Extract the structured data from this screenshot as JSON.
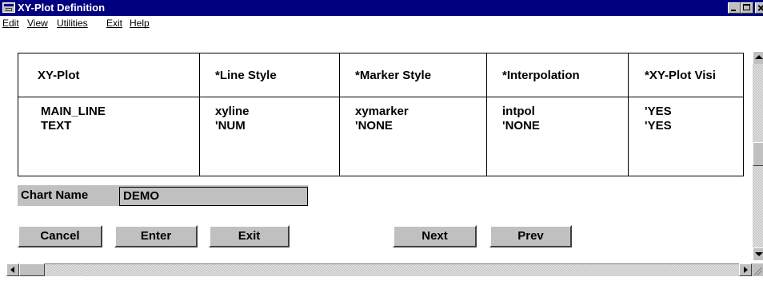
{
  "window": {
    "title": "XY-Plot Definition"
  },
  "menu": {
    "items": [
      {
        "label": "Edit"
      },
      {
        "label": "View"
      },
      {
        "label": "Utilities"
      },
      {
        "label": "Exit"
      },
      {
        "label": "Help"
      }
    ]
  },
  "table": {
    "headers": [
      "XY-Plot",
      "*Line Style",
      "*Marker Style",
      "*Interpolation",
      "*XY-Plot Visi"
    ],
    "rows": [
      [
        "MAIN_LINE",
        "xyline",
        "xymarker",
        "intpol",
        "'YES"
      ],
      [
        "TEXT",
        "'NUM",
        "'NONE",
        "'NONE",
        "'YES"
      ]
    ]
  },
  "chart": {
    "label": "Chart Name",
    "value": "DEMO"
  },
  "buttons": {
    "cancel": "Cancel",
    "enter": "Enter",
    "exit": "Exit",
    "next": "Next",
    "prev": "Prev"
  },
  "colors": {
    "titlebar": "#000080",
    "face": "#c0c0c0"
  }
}
